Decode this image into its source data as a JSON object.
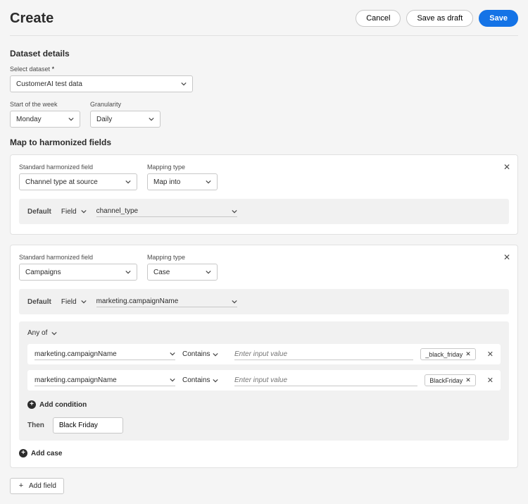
{
  "header": {
    "title": "Create",
    "cancel": "Cancel",
    "save_draft": "Save as draft",
    "save": "Save"
  },
  "dataset": {
    "section_title": "Dataset details",
    "select_label": "Select dataset",
    "select_required": "*",
    "select_value": "CustomerAI test data",
    "start_label": "Start of the week",
    "start_value": "Monday",
    "gran_label": "Granularity",
    "gran_value": "Daily"
  },
  "mapping": {
    "section_title": "Map to harmonized fields",
    "std_label": "Standard harmonized field",
    "type_label": "Mapping type",
    "default_btn": "Default",
    "field_btn": "Field",
    "anyof": "Any of",
    "contains": "Contains",
    "input_placeholder": "Enter input value",
    "then_label": "Then",
    "add_condition": "Add condition",
    "add_case": "Add case",
    "add_field": "Add field",
    "card1": {
      "std_value": "Channel type at source",
      "type_value": "Map into",
      "default_field": "channel_type"
    },
    "card2": {
      "std_value": "Campaigns",
      "type_value": "Case",
      "default_field": "marketing.campaignName",
      "row1": {
        "field": "marketing.campaignName",
        "tag": "_black_friday"
      },
      "row2": {
        "field": "marketing.campaignName",
        "tag": "BlackFriday"
      },
      "then_value": "Black Friday"
    }
  }
}
